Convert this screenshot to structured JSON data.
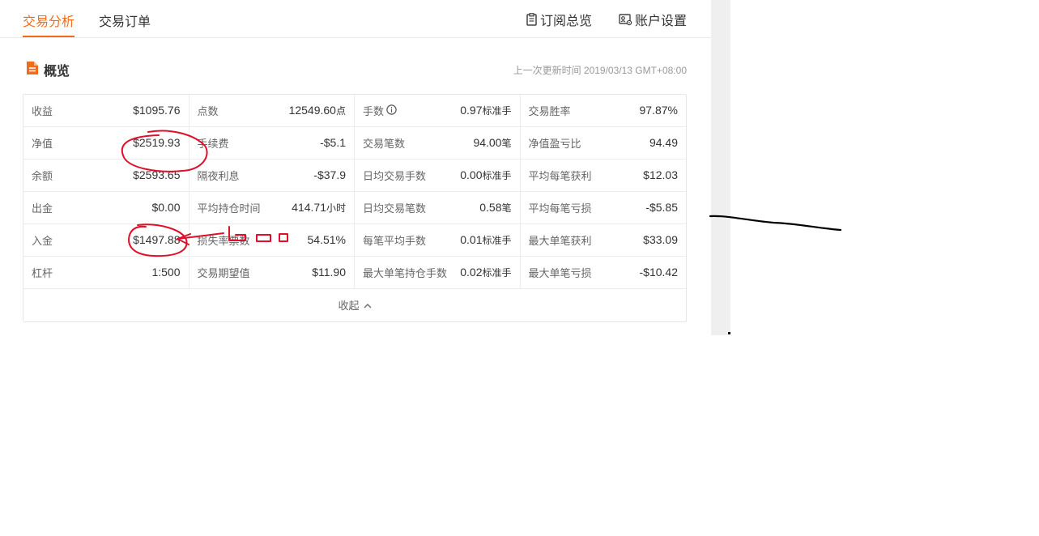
{
  "tabs": {
    "items": [
      {
        "label": "交易分析",
        "active": true
      },
      {
        "label": "交易订单",
        "active": false
      }
    ],
    "right": [
      {
        "label": "订阅总览",
        "icon": "clipboard-icon"
      },
      {
        "label": "账户设置",
        "icon": "account-settings-icon"
      }
    ]
  },
  "overview": {
    "title": "概览",
    "icon": "document-icon",
    "updated": "上一次更新时间 2019/03/13 GMT+08:00"
  },
  "stats": {
    "rows": [
      [
        {
          "label": "收益",
          "value": "$1095.76",
          "unit": ""
        },
        {
          "label": "点数",
          "value": "12549.60",
          "unit": "点"
        },
        {
          "label": "手数",
          "value": "0.97",
          "unit": "标准手",
          "info": true
        },
        {
          "label": "交易胜率",
          "value": "97.87%",
          "unit": ""
        }
      ],
      [
        {
          "label": "净值",
          "value": "$2519.93",
          "unit": ""
        },
        {
          "label": "手续费",
          "value": "-$5.1",
          "unit": ""
        },
        {
          "label": "交易笔数",
          "value": "94.00",
          "unit": "笔"
        },
        {
          "label": "净值盈亏比",
          "value": "94.49",
          "unit": ""
        }
      ],
      [
        {
          "label": "余额",
          "value": "$2593.65",
          "unit": ""
        },
        {
          "label": "隔夜利息",
          "value": "-$37.9",
          "unit": ""
        },
        {
          "label": "日均交易手数",
          "value": "0.00",
          "unit": "标准手"
        },
        {
          "label": "平均每笔获利",
          "value": "$12.03",
          "unit": ""
        }
      ],
      [
        {
          "label": "出金",
          "value": "$0.00",
          "unit": ""
        },
        {
          "label": "平均持仓时间",
          "value": "414.71",
          "unit": "小时"
        },
        {
          "label": "日均交易笔数",
          "value": "0.58",
          "unit": "笔"
        },
        {
          "label": "平均每笔亏损",
          "value": "-$5.85",
          "unit": ""
        }
      ],
      [
        {
          "label": "入金",
          "value": "$1497.88",
          "unit": ""
        },
        {
          "label": "损失率票数",
          "value": "54.51%",
          "unit": ""
        },
        {
          "label": "每笔平均手数",
          "value": "0.01",
          "unit": "标准手"
        },
        {
          "label": "最大单笔获利",
          "value": "$33.09",
          "unit": ""
        }
      ],
      [
        {
          "label": "杠杆",
          "value": "1:500",
          "unit": ""
        },
        {
          "label": "交易期望值",
          "value": "$11.90",
          "unit": ""
        },
        {
          "label": "最大单笔持仓手数",
          "value": "0.02",
          "unit": "标准手"
        },
        {
          "label": "最大单笔亏损",
          "value": "-$10.42",
          "unit": ""
        }
      ]
    ],
    "collapse_label": "收起"
  },
  "colors": {
    "accent": "#f26b1d",
    "annotation": "#e0102a",
    "pen": "#000000"
  }
}
